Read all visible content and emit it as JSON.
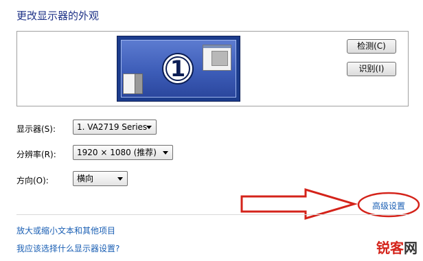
{
  "page_title": "更改显示器的外观",
  "preview": {
    "monitor_number": "1"
  },
  "buttons": {
    "detect": "检测(C)",
    "identify": "识别(I)"
  },
  "display": {
    "label": "显示器(S):",
    "value": "1. VA2719 Series"
  },
  "resolution": {
    "label": "分辨率(R):",
    "value": "1920 × 1080 (推荐)"
  },
  "orientation": {
    "label": "方向(O):",
    "value": "横向"
  },
  "advanced_link": "高级设置",
  "links": {
    "text_size": "放大或缩小文本和其他项目",
    "which_settings": "我应该选择什么显示器设置?"
  },
  "watermark": {
    "brand": "锐客网"
  },
  "colors": {
    "title": "#1e3287",
    "link": "#1a5fb4",
    "annotation_red": "#d4231a",
    "monitor_blue": "#1c3c8c"
  }
}
